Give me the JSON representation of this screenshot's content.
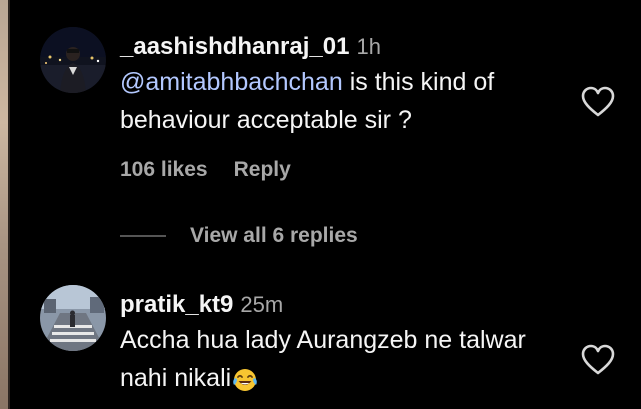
{
  "comments": [
    {
      "username": "_aashishdhanraj_01",
      "time": "1h",
      "mention": "@amitabhbachchan",
      "text": " is this kind of behaviour acceptable sir ?",
      "likes": "106 likes",
      "reply_label": "Reply",
      "view_replies": "View all 6 replies",
      "avatar_icon": "profile-photo-night-city"
    },
    {
      "username": "pratik_kt9",
      "time": "25m",
      "text": "Accha hua lady Aurangzeb ne talwar nahi nikali",
      "emoji": "😂",
      "avatar_icon": "profile-photo-road-crossing"
    }
  ],
  "icons": {
    "like": "heart-outline-icon",
    "emoji": "tears-of-joy-emoji"
  },
  "colors": {
    "background": "#000000",
    "text": "#f5f5f5",
    "secondary_text": "#a8a8a8",
    "mention": "#b3c8ff"
  }
}
